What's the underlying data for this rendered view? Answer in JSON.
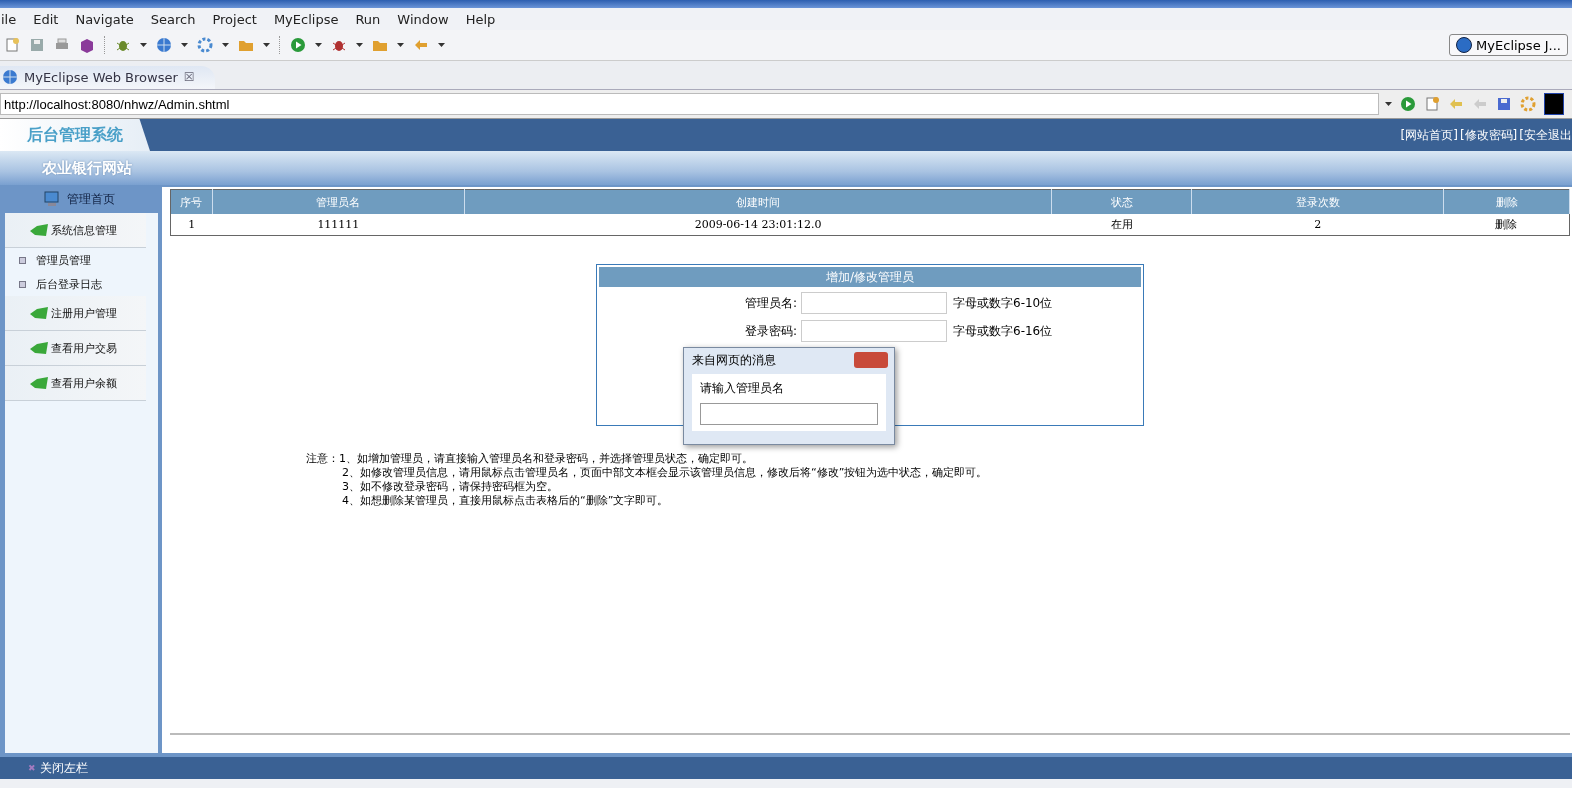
{
  "menu": [
    "ile",
    "Edit",
    "Navigate",
    "Search",
    "Project",
    "MyEclipse",
    "Run",
    "Window",
    "Help"
  ],
  "perspective": {
    "label": "MyEclipse J..."
  },
  "editor_tab": {
    "label": "MyEclipse Web Browser",
    "close": "☒"
  },
  "address_bar": {
    "value": "http://localhost:8080/nhwz/Admin.shtml"
  },
  "page": {
    "logo": "后台管理系统",
    "subtitle": "农业银行网站",
    "header_links": [
      "[网站首页]",
      "[修改密码]",
      "[安全退出"
    ],
    "sidebar": {
      "home": "管理首页",
      "items": [
        {
          "label": "系统信息管理",
          "children": [
            {
              "label": "管理员管理"
            },
            {
              "label": "后台登录日志"
            }
          ]
        },
        {
          "label": "注册用户管理"
        },
        {
          "label": "查看用户交易"
        },
        {
          "label": "查看用户余额"
        }
      ]
    },
    "table": {
      "columns": [
        "序号",
        "管理员名",
        "创建时间",
        "状态",
        "登录次数",
        "删除"
      ],
      "rows": [
        [
          "1",
          "111111",
          "2009-06-14 23:01:12.0",
          "在用",
          "2",
          "删除"
        ]
      ]
    },
    "form": {
      "title": "增加/修改管理员",
      "fields": [
        {
          "label": "管理员名:",
          "hint": "字母或数字6-10位"
        },
        {
          "label": "登录密码:",
          "hint": "字母或数字6-16位"
        }
      ]
    },
    "dialog": {
      "title": "来自网页的消息",
      "message": "请输入管理员名"
    },
    "notes": [
      "注意：1、如增加管理员，请直接输入管理员名和登录密码，并选择管理员状态，确定即可。",
      "2、如修改管理员信息，请用鼠标点击管理员名，页面中部文本框会显示该管理员信息，修改后将“修改”按钮为选中状态，确定即可。",
      "3、如不修改登录密码，请保持密码框为空。",
      "4、如想删除某管理员，直接用鼠标点击表格后的“删除”文字即可。"
    ],
    "footer_icon": "✖",
    "footer": "关闭左栏"
  }
}
